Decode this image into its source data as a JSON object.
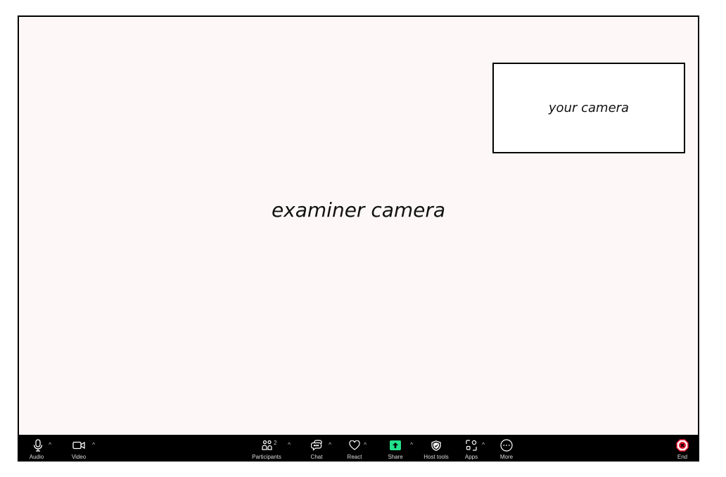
{
  "stage": {
    "examiner_label": "examiner camera",
    "self_label": "your camera"
  },
  "toolbar": {
    "audio": {
      "label": "Audio",
      "icon": "microphone-icon"
    },
    "video": {
      "label": "Video",
      "icon": "video-camera-icon"
    },
    "participants": {
      "label": "Participants",
      "icon": "participants-icon",
      "count": "2"
    },
    "chat": {
      "label": "Chat",
      "icon": "chat-icon"
    },
    "react": {
      "label": "React",
      "icon": "heart-icon"
    },
    "share": {
      "label": "Share",
      "icon": "share-screen-icon"
    },
    "host_tools": {
      "label": "Host tools",
      "icon": "shield-icon"
    },
    "apps": {
      "label": "Apps",
      "icon": "apps-icon"
    },
    "more": {
      "label": "More",
      "icon": "more-icon"
    },
    "end": {
      "label": "End",
      "icon": "end-call-icon"
    },
    "caret": "^"
  },
  "colors": {
    "stage_bg": "#fdf8f7",
    "toolbar_bg": "#000000",
    "share_accent": "#22e08a",
    "end_accent": "#e0112b"
  }
}
